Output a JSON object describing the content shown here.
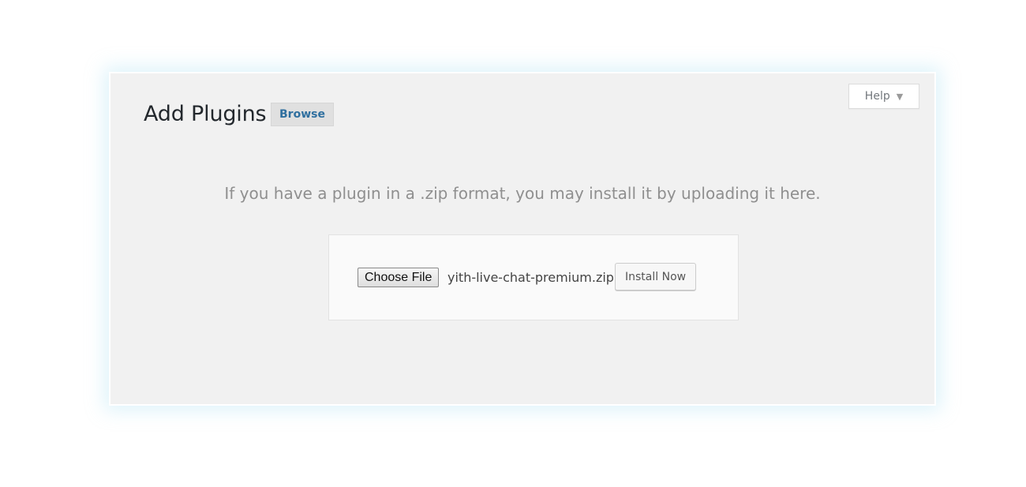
{
  "header": {
    "title": "Add Plugins",
    "browse_label": "Browse",
    "help_label": "Help"
  },
  "upload": {
    "instructions": "If you have a plugin in a .zip format, you may install it by uploading it here.",
    "choose_file_label": "Choose File",
    "file_name": "yith-live-chat-premium.zip",
    "install_label": "Install Now"
  },
  "icons": {
    "help_caret": "caret-down-icon"
  },
  "colors": {
    "panel_background": "#f1f1f1",
    "link_blue": "#2f6f9f",
    "title_text": "#23282d"
  }
}
